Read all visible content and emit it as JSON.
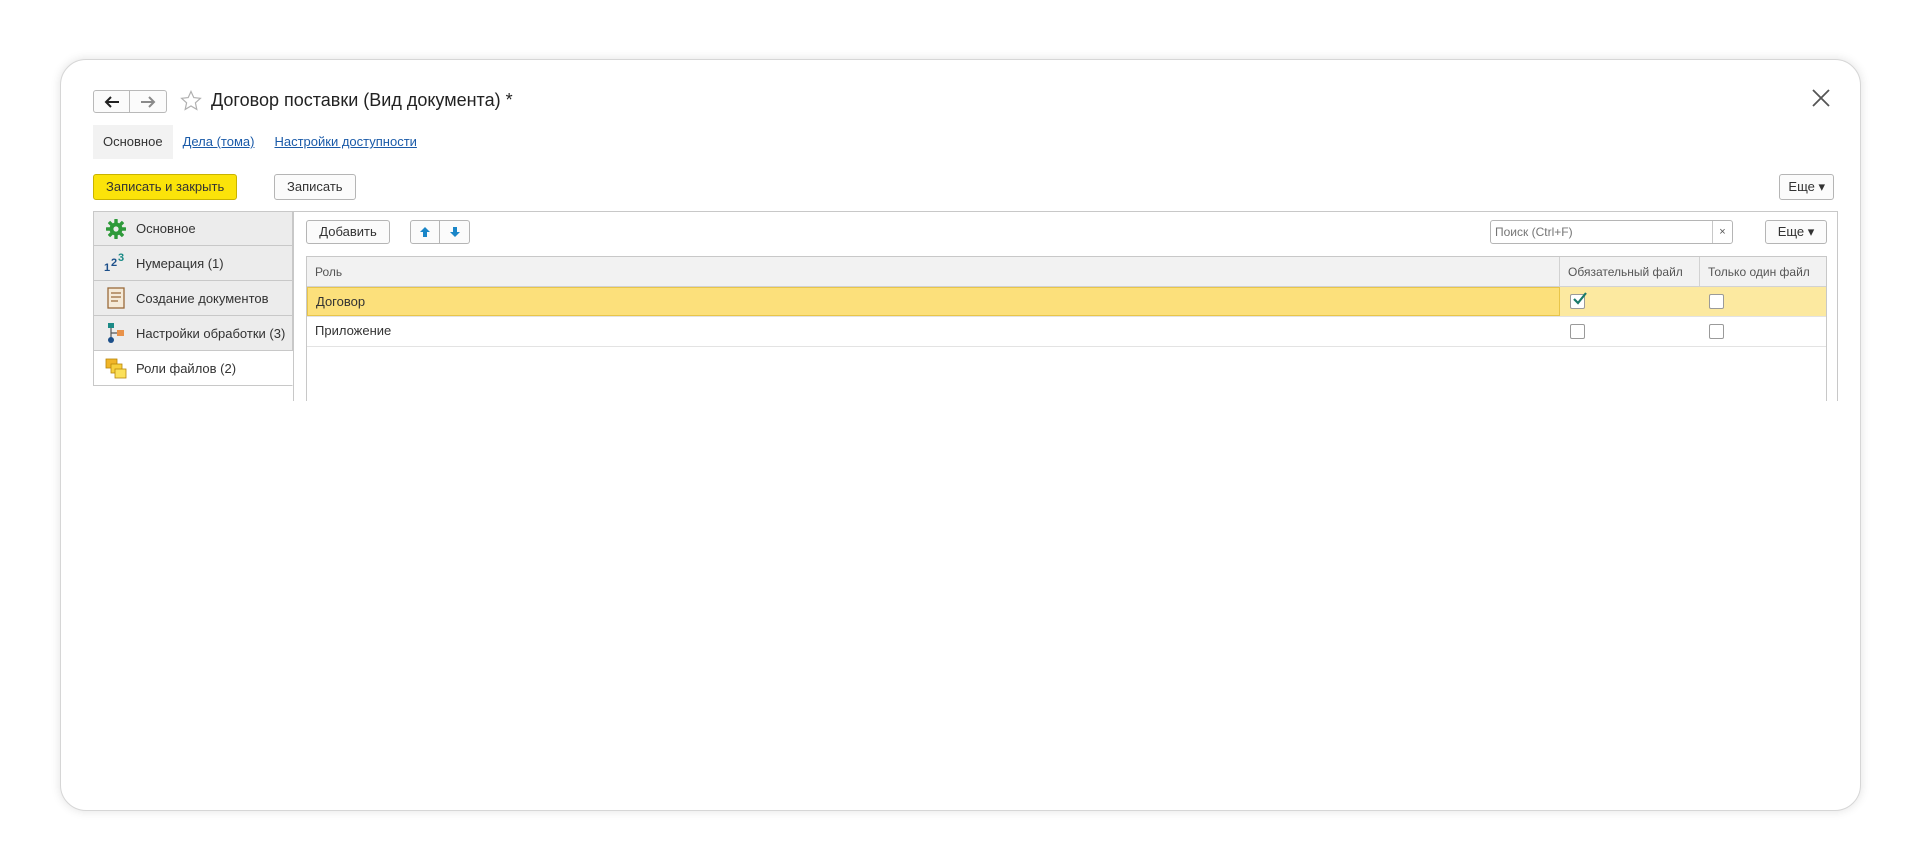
{
  "window": {
    "title": "Договор поставки (Вид документа) *",
    "close_icon": "close-icon",
    "star_icon": "star-icon"
  },
  "tabs": [
    {
      "label": "Основное",
      "active": true
    },
    {
      "label": "Дела (тома)",
      "active": false
    },
    {
      "label": "Настройки доступности",
      "active": false
    }
  ],
  "toolbar": {
    "save_close_label": "Записать и закрыть",
    "save_label": "Записать",
    "more_label": "Еще ▾"
  },
  "sidenav": {
    "items": [
      {
        "label": "Основное",
        "icon": "gear-icon"
      },
      {
        "label": "Нумерация (1)",
        "icon": "numbering-icon"
      },
      {
        "label": "Создание документов",
        "icon": "document-icon"
      },
      {
        "label": "Настройки обработки (3)",
        "icon": "workflow-icon"
      },
      {
        "label": "Роли файлов (2)",
        "icon": "files-icon",
        "active": true
      }
    ]
  },
  "files_toolbar": {
    "add_label": "Добавить",
    "search_placeholder": "Поиск (Ctrl+F)",
    "clear_label": "×",
    "more_label": "Еще ▾"
  },
  "table": {
    "columns": [
      "Роль",
      "Обязательный файл",
      "Только один файл"
    ],
    "rows": [
      {
        "role": "Договор",
        "required": true,
        "only_one": false,
        "selected": true
      },
      {
        "role": "Приложение",
        "required": false,
        "only_one": false,
        "selected": false
      }
    ]
  },
  "colors": {
    "primary_button": "#fbe30a",
    "link": "#1a5aa8",
    "selected_row": "#fce9a0",
    "accent_teal": "#1a8a86"
  }
}
